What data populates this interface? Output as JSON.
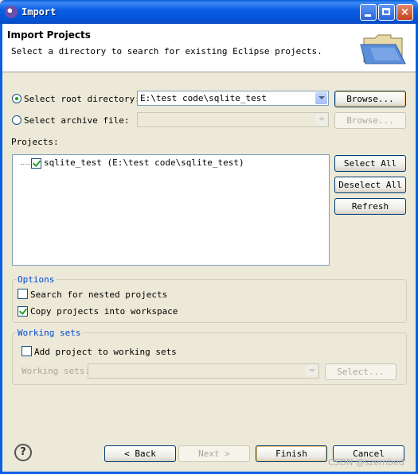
{
  "window": {
    "title": "Import",
    "minimize": "min",
    "maximize": "max",
    "close": "×"
  },
  "header": {
    "title": "Import Projects",
    "description": "Select a directory to search for existing Eclipse projects."
  },
  "source": {
    "root_radio_label": "Select root directory:",
    "root_selected": true,
    "root_path": "E:\\test code\\sqlite_test",
    "root_browse": "Browse...",
    "archive_radio_label": "Select archive file:",
    "archive_path": "",
    "archive_browse": "Browse..."
  },
  "projects": {
    "label": "Projects:",
    "items": [
      {
        "label": "sqlite_test (E:\\test code\\sqlite_test)",
        "checked": true
      }
    ],
    "select_all": "Select All",
    "deselect_all": "Deselect All",
    "refresh": "Refresh"
  },
  "options": {
    "label": "Options",
    "nested": {
      "label": "Search for nested projects",
      "checked": false
    },
    "copy": {
      "label": "Copy projects into workspace",
      "checked": true
    }
  },
  "working_sets": {
    "label": "Working sets",
    "add": {
      "label": "Add project to working sets",
      "checked": false
    },
    "sets_label": "Working sets:",
    "sets_value": "",
    "select": "Select..."
  },
  "footer": {
    "help": "?",
    "back": "< Back",
    "next": "Next >",
    "finish": "Finish",
    "cancel": "Cancel"
  },
  "watermark": "CSDN @szembed",
  "colors": {
    "titlebar": "#0b5fe3",
    "dialog_bg": "#ece9d8",
    "group_label": "#0046d5",
    "check": "#21a121"
  }
}
